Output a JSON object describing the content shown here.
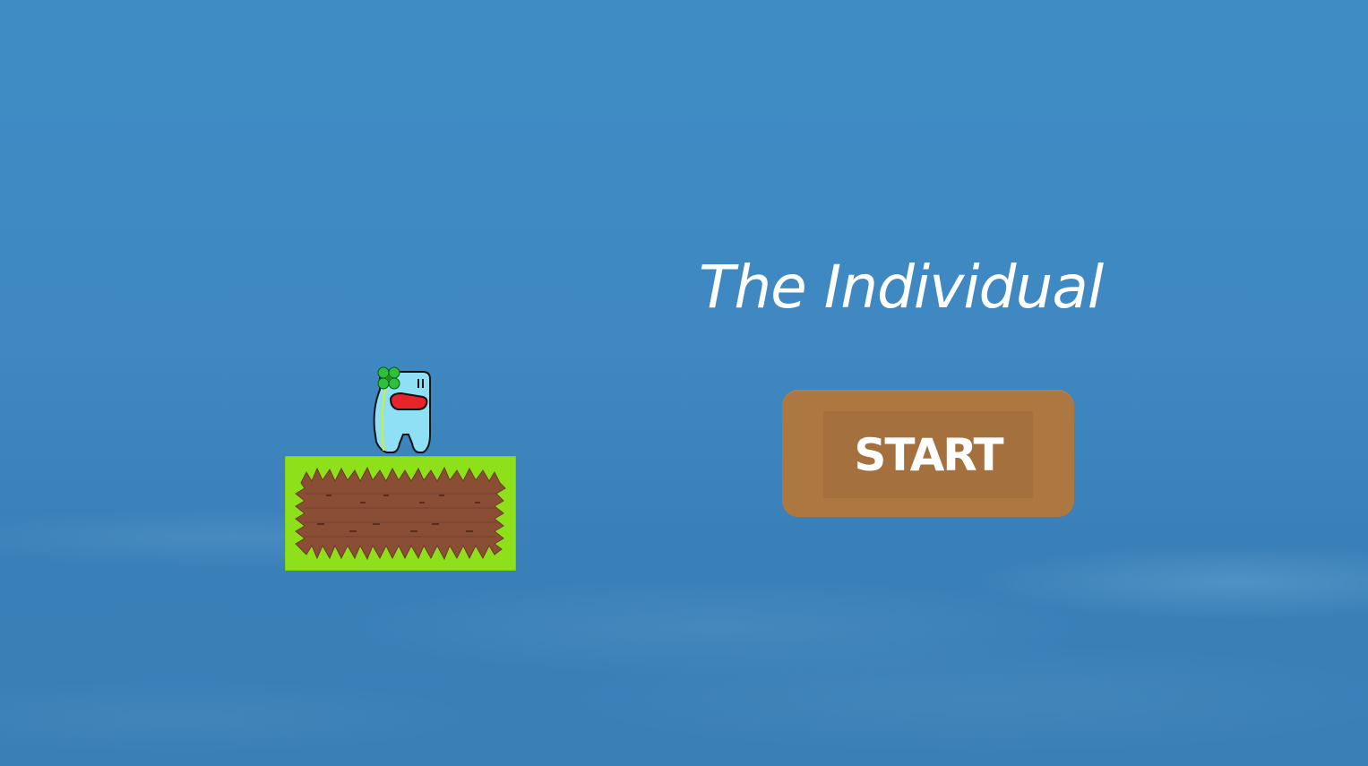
{
  "game": {
    "title": "The Individual",
    "start_label": "START"
  },
  "colors": {
    "sky": "#3f88c1",
    "button": "#ad7741",
    "button_inner": "#a4703d",
    "grass": "#8ee01a",
    "dirt": "#8a4e35",
    "character_body": "#8fe0f5",
    "character_mouth": "#e8232a",
    "clover": "#2fbf3a"
  },
  "icons": {
    "character": "blue-blob-character-with-clover",
    "platform": "grass-dirt-block"
  }
}
